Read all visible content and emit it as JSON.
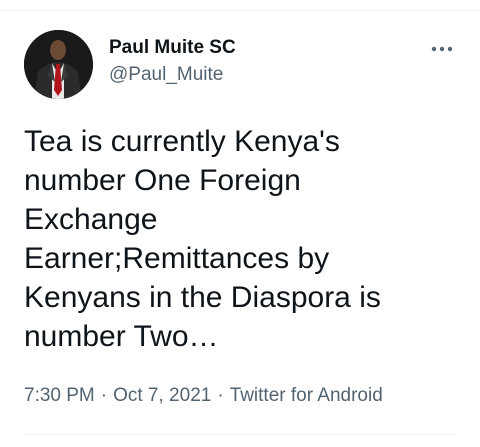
{
  "author": {
    "display_name": "Paul Muite SC",
    "handle": "@Paul_Muite",
    "avatar_icon": "profile-photo"
  },
  "tweet": {
    "text": "Tea is currently Kenya's\nnumber One Foreign\nExchange\nEarner;Remittances by\nKenyans in the Diaspora is\nnumber Two…"
  },
  "meta": {
    "time": "7:30 PM",
    "separator": "·",
    "date": "Oct 7, 2021",
    "source": "Twitter for Android"
  },
  "icons": {
    "more": "more-horizontal-icon"
  },
  "colors": {
    "text_primary": "#0f1419",
    "text_secondary": "#536471",
    "divider": "#eff3f4"
  }
}
